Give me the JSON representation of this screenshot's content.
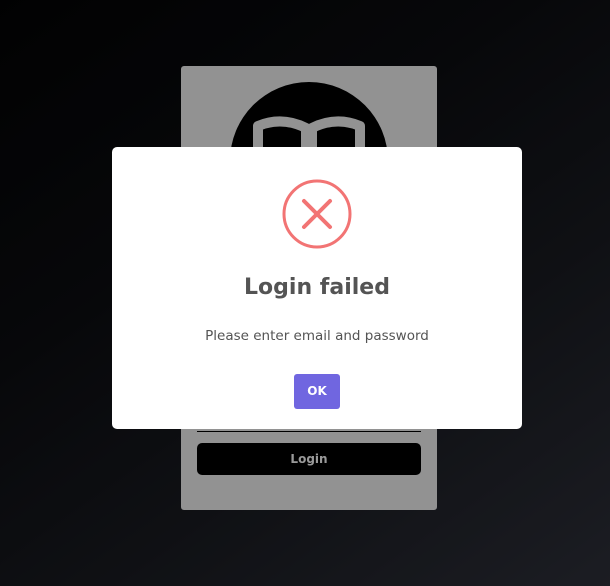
{
  "login_card": {
    "logo_icon": "open-book-icon",
    "login_label": "Login"
  },
  "dialog": {
    "icon": "error-x-icon",
    "title": "Login failed",
    "message": "Please enter email and password",
    "ok_label": "OK"
  },
  "colors": {
    "error_icon": "#f27474",
    "ok_button": "#7066e0",
    "text": "#545454",
    "card_background": "#f4f4f4"
  }
}
